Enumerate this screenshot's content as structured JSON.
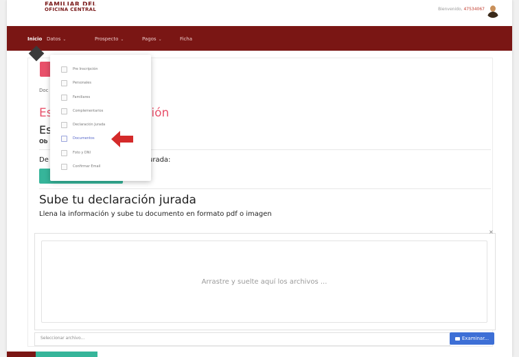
{
  "header": {
    "brand_top": "FAMILIAR DEL",
    "brand_sub": "OFICINA CENTRAL",
    "user_prefix": "Bienvenido,",
    "user_id": "47534067"
  },
  "nav": {
    "items": [
      {
        "label": "Inicio",
        "active": true
      },
      {
        "label": "Datos",
        "has_caret": true
      },
      {
        "label": "Prospecto",
        "has_caret": true
      },
      {
        "label": "Pagos",
        "has_caret": true
      },
      {
        "label": "Ficha"
      }
    ]
  },
  "dropdown": {
    "items": [
      {
        "label": "Pre Inscripción"
      },
      {
        "label": "Personales"
      },
      {
        "label": "Familiares"
      },
      {
        "label": "Complementarios"
      },
      {
        "label": "Declaración Jurada"
      },
      {
        "label": "Documentos",
        "selected": true
      },
      {
        "label": "Foto y DNI"
      },
      {
        "label": "Confirmar Email"
      }
    ]
  },
  "content": {
    "doc_label": "Doc",
    "red_title_start": "Es",
    "red_title_end": "ción",
    "dark_title": "Es",
    "obs_label": "Ob",
    "decl_start": "De",
    "decl_end": "urada:",
    "upload_title": "Sube tu declaración jurada",
    "upload_sub": "Llena la información y sube tu documento en formato pdf o imagen",
    "drop_text": "Arrastre y suelte aquí los archivos ...",
    "file_placeholder": "Seleccionar archivo...",
    "browse_label": "Examinar...",
    "close_symbol": "×"
  },
  "colors": {
    "nav_bg": "#7a1614",
    "accent_pink": "#e8506a",
    "teal": "#36b59a",
    "blue": "#3d6fd6",
    "arrow": "#d42a2a"
  },
  "icons": [
    "user-icon",
    "folder-icon",
    "arrow-left-icon",
    "close-icon"
  ]
}
